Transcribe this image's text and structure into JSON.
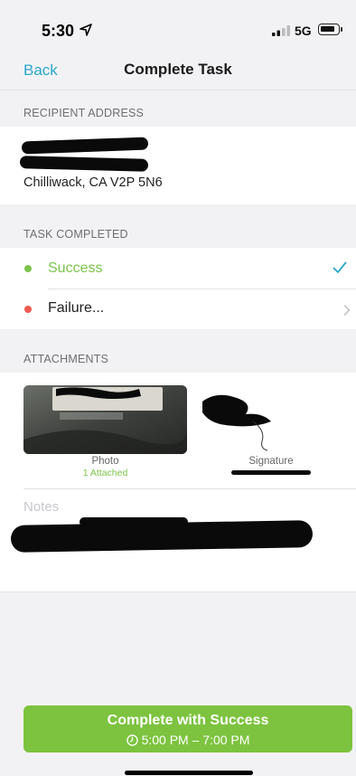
{
  "status_bar": {
    "time": "5:30",
    "network": "5G"
  },
  "nav": {
    "back_label": "Back",
    "title": "Complete Task"
  },
  "recipient": {
    "header": "RECIPIENT ADDRESS",
    "address_line": "Chilliwack, CA V2P 5N6"
  },
  "task_completed": {
    "header": "TASK COMPLETED",
    "options": [
      {
        "label": "Success",
        "color": "#7cc44b",
        "selected": true
      },
      {
        "label": "Failure...",
        "color": "#ee5b52",
        "selected": false
      }
    ]
  },
  "attachments": {
    "header": "ATTACHMENTS",
    "photo": {
      "label": "Photo",
      "status": "1 Attached"
    },
    "signature": {
      "label": "Signature"
    }
  },
  "notes": {
    "placeholder": "Notes"
  },
  "complete_button": {
    "title": "Complete with Success",
    "time_window": "5:00 PM – 7:00 PM",
    "color": "#7dc33f"
  },
  "colors": {
    "accent": "#2aa7c9",
    "success": "#7cc44b",
    "failure": "#ee5b52"
  }
}
